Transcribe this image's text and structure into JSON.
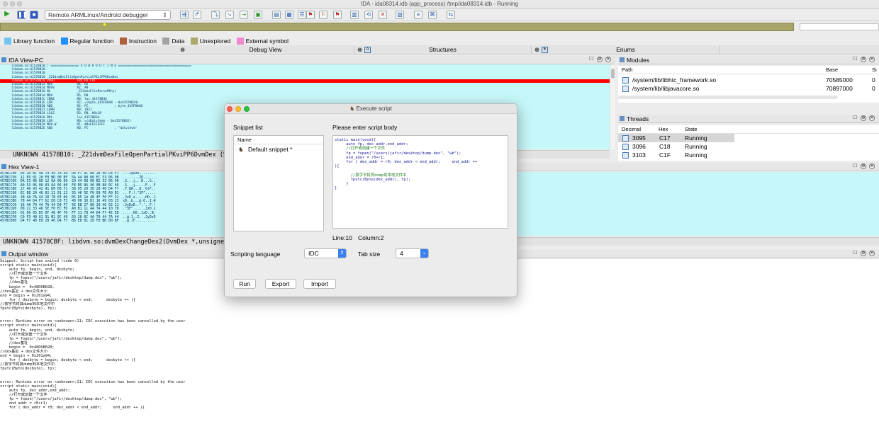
{
  "window": {
    "title": "IDA - ida08314.idb (app_process) /tmp/ida08314.idb - Running"
  },
  "toolbar": {
    "debugger_select": "Remote ARMLinux/Android debugger"
  },
  "legend": [
    {
      "label": "Library function",
      "color": "#71c5f0"
    },
    {
      "label": "Regular function",
      "color": "#1e90ff"
    },
    {
      "label": "Instruction",
      "color": "#b0603c"
    },
    {
      "label": "Data",
      "color": "#a3a3a3"
    },
    {
      "label": "Unexplored",
      "color": "#aaa86a"
    },
    {
      "label": "External symbol",
      "color": "#f08ad0"
    }
  ],
  "tabs": [
    "Debug View",
    "Structures",
    "Enums"
  ],
  "ida_view": {
    "title": "IDA View-PC",
    "lines": [
      "libdvm.so:41578B10 ; =============== S U B R O U T I N E =======================================",
      "libdvm.so:41578B10",
      "libdvm.so:41578B10",
      "libdvm.so:41578B10 _Z21dvmDexFileOpenPartialPKviPP6DvmDex",
      "libdvm.so:41578B10 PUSH            {R4-R6,LR}",
      "libdvm.so:41578B12 MOV             R4, R2",
      "libdvm.so:41578B14 MOVS            R2, #0",
      "libdvm.so:41578B16 BL              _Z12dexFileParsePKhji",
      "libdvm.so:41578B1A MOV             R5, R0",
      "libdvm.so:41578B1C CBNZ            R0, loc_41578B4A",
      "libdvm.so:41578B1E LDR             R2, =(byte_415FD048 - 0x41578B24)",
      "libdvm.so:41578B20 ADD             R2, PC              ; byte_415FD048",
      "libdvm.so:41578B22 LDRB            R0, [R2]",
      "libdvm.so:41578B24 LSLS            R3, R0, #0x18",
      "libdvm.so:41578B26 BPL             loc_41578B34",
      "libdvm.so:41578B28 LDR             R0, =(aDalvikvm - 0x41578B32)",
      "libdvm.so:41578B2A MOV.W           R1, #0xFFFFFFFF",
      "libdvm.so:41578B2E ADD             R0, PC              ; \"dalvikvm\""
    ],
    "highlight_index": 4,
    "breakpoint_index": 4,
    "status": "UNKNOWN  41578B10: _Z21dvmDexFileOpenPartialPKviPP6DvmDex (Sync"
  },
  "hex_view": {
    "title": "Hex View-1",
    "lines": [
      "4578CC40  03 20 0C 4A 79 44 7A 44  D4 F7 9C E8 28 46 D4 F7  .·.JyDzD........",
      "4578CC50  12 E9 01 20 F8 BD 00 BF  5A 44 08 00 EC 53 06 00  ........ZD.......",
      "4578CC60  DA 53 06 00 12 6A 06 00  20 44 08 00 B2 53 06 00  .S...j.. D...S..",
      "4578CC70  A0 53 06 00 03 6A 06 00  F8 B5 06 46 0B 88 0C 46  .S...j.....F...F",
      "4578CC80  17 46 93 42 41 D0 00 F1  38 05 20 36 28 46 D4 F7  .F.BA...8. 6(F..",
      "4578CC90  EC E8 20 46 02 21 01 22  33 46 5E F0 09 FE A0 B1  .. F.!.\"3F^.....",
      "4578CCA0  1B 4A 7A 44 10 78 03 06  05 D5 1A 48 4F F0 FF 31  .JzD.x.....HO..1",
      "4578CCB0  78 44 D4 F7 62 E8 C0 F3  40 00 30 B1 16 49 03 23  xD..b...@.0..I.#",
      "4578CCC0  16 4A 79 44 7A 44 D4 F7  5E E8 27 80 20 46 02 21  .JyDzD..^.'. F.!",
      "4578CCD0  00 22 33 46 5E F0 EC FD  A0 B1 11 4A 7A 44 10 78  .\"3F^......JzD.x",
      "4578CCE0  01 06 05 D5 0F 48 4F F0  FF 31 78 44 D4 F7 4E E8  .....HO..1xD..N.",
      "4578CCF0  C0 F3 40 01 31 B1 0C 49  03 20 0C 4A 79 44 7A 44  ..@.1..I. .JyDzD",
      "4578CD00  D4 F7 40 E8 28 46 D4 F7  B6 E8 01 20 F8 BD 00 BF  ..@.(F..... ...."
    ],
    "status": "UNKNOWN  41578CBF: libdvm.so:dvmDexChangeDex2(DvmDex *,unsigned short"
  },
  "output": {
    "title": "Output window",
    "lines": [
      "Snippet: Script has exited (code 0)",
      "script static main(void){",
      "    auto fp, begin, end, dexbyte;",
      "    //打开或创建一个文件",
      "    fp = fopen(\"/users/jafir/desktop/dump.dex\", \"wb\");",
      "    //dex基址",
      "    begin =  0x48D6B028;",
      "//dex基址 + dex文件大小",
      "end = begin + 0x261a94;",
      "    for ( dexbyte = begin; dexbyte < end;      dexbyte ++ ){",
      "//按字节将其dump到本地文件中",
      "fputc(Byte(dexbyte), fp);",
      "",
      "",
      "error: Runtime error on <unknown>:11: IDC execution has been cancelled by the user",
      "script static main(void){",
      "    auto fp, begin, end, dexbyte;",
      "    //打开或创建一个文件",
      "    fp = fopen(\"/users/jafir/desktop/dump.dex\", \"wb\");",
      "    //dex基址",
      "    begin =  0x48D6B028;",
      "//dex基址 + dex文件大小",
      "end = begin + 0x261a94;",
      "    for ( dexbyte = begin; dexbyte < end;      dexbyte ++ ){",
      "//按字节将其dump到本地文件中",
      "fputc(Byte(dexbyte), fp);",
      "",
      "",
      "error: Runtime error on <unknown>:11: IDC execution has been cancelled by the user",
      "script static main(void){",
      "    auto fp, dex_addr,end_addr;",
      "    //打开或创建一个文件",
      "    fp = fopen(\"/users/jafir/desktop/dump.dex\", \"wb\");",
      "    end_addr = r0+r1;",
      "    for ( dex_addr = r0; dex_addr < end_addr;     end_addr ++ ){"
    ]
  },
  "modules": {
    "title": "Modules",
    "columns": [
      "Path",
      "Base",
      "Si"
    ],
    "rows": [
      {
        "path": "/system/lib/libhtc_framework.so",
        "base": "70585000",
        "size": "0"
      },
      {
        "path": "/system/lib/libjavacore.so",
        "base": "70897000",
        "size": "0"
      }
    ]
  },
  "threads": {
    "title": "Threads",
    "columns": [
      "Decimal",
      "Hex",
      "State"
    ],
    "rows": [
      {
        "decimal": "3095",
        "hex": "C17",
        "state": "Running"
      },
      {
        "decimal": "3096",
        "hex": "C18",
        "state": "Running"
      },
      {
        "decimal": "3103",
        "hex": "C1F",
        "state": "Running"
      }
    ]
  },
  "dialog": {
    "title": "Execute script",
    "snippet_list_label": "Snippet list",
    "snippet_col": "Name",
    "snippet_item": "Default snippet *",
    "body_label": "Please enter script body",
    "script_lines": [
      {
        "t": "static main(void){",
        "c": false
      },
      {
        "t": "     auto fp, dex_addr,end_addr;",
        "c": false
      },
      {
        "t": "     //打开或创建一个文件",
        "c": true
      },
      {
        "t": "     fp = fopen(\"/users/jafir/desktop/dump.dex\", \"wb\");",
        "c": false
      },
      {
        "t": "     end_addr = r0+r1;",
        "c": false
      },
      {
        "t": "     for ( dex_addr = r0; dex_addr < end_addr;     end_addr ++",
        "c": false
      },
      {
        "t": "){",
        "c": false
      },
      {
        "t": "",
        "c": false
      },
      {
        "t": "       //按字节将其dump到本地文件中",
        "c": true
      },
      {
        "t": "       fputc(Byte(dex_addr), fp);",
        "c": false
      },
      {
        "t": "     }",
        "c": false
      },
      {
        "t": "}",
        "c": false
      }
    ],
    "line_label": "Line:10",
    "column_label": "Column:2",
    "scripting_language_label": "Scripting language",
    "scripting_language_value": "IDC",
    "tab_size_label": "Tab size",
    "tab_size_value": "4",
    "run_label": "Run",
    "export_label": "Export",
    "import_label": "Import"
  }
}
